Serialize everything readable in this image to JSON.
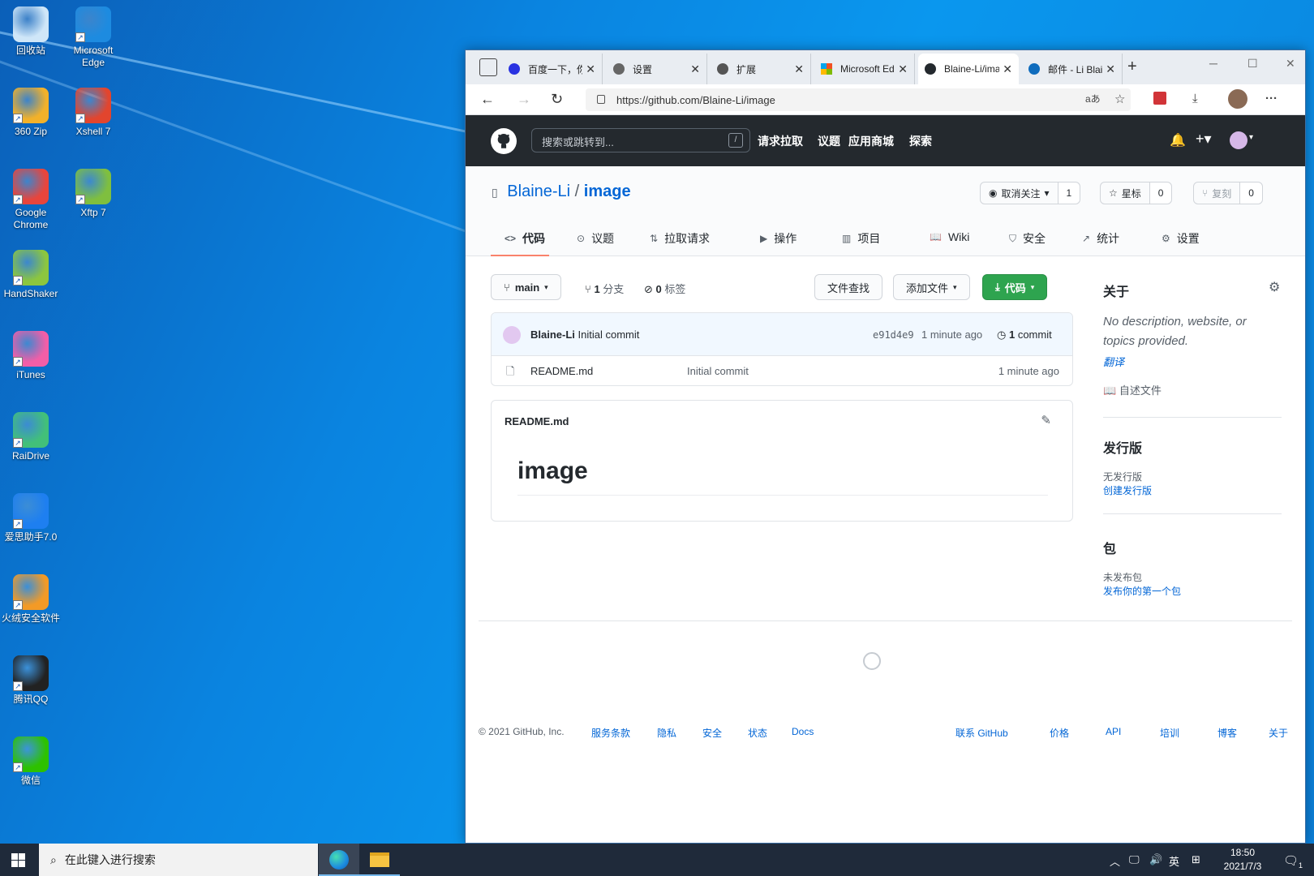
{
  "desktop": {
    "icons": [
      {
        "label": "回收站",
        "icon": "recycle-bin-icon",
        "color": "#cfe6f8"
      },
      {
        "label": "Microsoft Edge",
        "icon": "edge-icon",
        "color": "#1d8be0"
      },
      {
        "label": "360 Zip",
        "icon": "zip-archive-icon",
        "color": "#f2b12a"
      },
      {
        "label": "Xshell 7",
        "icon": "xshell-icon",
        "color": "#e2452e"
      },
      {
        "label": "Google Chrome",
        "icon": "chrome-icon",
        "color": "#e8453c"
      },
      {
        "label": "Xftp 7",
        "icon": "xftp-icon",
        "color": "#7fbf3f"
      },
      {
        "label": "HandShaker",
        "icon": "android-icon",
        "color": "#8cc63f"
      },
      {
        "label": "iTunes",
        "icon": "itunes-icon",
        "color": "#f25ea7"
      },
      {
        "label": "RaiDrive",
        "icon": "raidrive-icon",
        "color": "#42c079"
      },
      {
        "label": "爱思助手7.0",
        "icon": "i4-assistant-icon",
        "color": "#1e7ff0"
      },
      {
        "label": "火绒安全软件",
        "icon": "huorong-flame-icon",
        "color": "#f39a26"
      },
      {
        "label": "腾讯QQ",
        "icon": "qq-penguin-icon",
        "color": "#222222"
      },
      {
        "label": "微信",
        "icon": "wechat-icon",
        "color": "#2dc100"
      }
    ]
  },
  "browser": {
    "tabs": [
      {
        "title": "百度一下，你",
        "icon": "baidu-paw-icon",
        "close": "✕"
      },
      {
        "title": "设置",
        "icon": "gear-icon",
        "close": "✕"
      },
      {
        "title": "扩展",
        "icon": "puzzle-icon",
        "close": "✕"
      },
      {
        "title": "Microsoft Edge",
        "icon": "microsoft-logo-icon",
        "close": "✕"
      },
      {
        "title": "Blaine-Li/image",
        "icon": "github-icon",
        "close": "✕"
      },
      {
        "title": "邮件 - Li Blaine",
        "icon": "outlook-icon",
        "close": "✕"
      }
    ],
    "new_tab": "+",
    "url": "https://github.com/Blaine-Li/image",
    "translate_glyph": "aあ",
    "window_controls": {
      "minimize": "─",
      "maximize": "☐",
      "close": "✕"
    }
  },
  "github": {
    "search_placeholder": "搜索或跳转到...",
    "search_key": "/",
    "nav": [
      "请求拉取",
      "议题",
      "应用商城",
      "探索"
    ],
    "repo_owner": "Blaine-Li",
    "repo_sep": "/",
    "repo_name": "image",
    "watch_label": "取消关注",
    "watch_count": "1",
    "star_label": "星标",
    "star_count": "0",
    "fork_label": "复刻",
    "fork_count": "0",
    "repo_tabs": [
      {
        "label": "代码",
        "icon": "code-icon"
      },
      {
        "label": "议题",
        "icon": "issue-icon"
      },
      {
        "label": "拉取请求",
        "icon": "pull-request-icon"
      },
      {
        "label": "操作",
        "icon": "actions-play-icon"
      },
      {
        "label": "项目",
        "icon": "project-icon"
      },
      {
        "label": "Wiki",
        "icon": "book-icon"
      },
      {
        "label": "安全",
        "icon": "shield-icon"
      },
      {
        "label": "统计",
        "icon": "graph-icon"
      },
      {
        "label": "设置",
        "icon": "gear-icon"
      }
    ],
    "branch": "main",
    "branches_count": "1",
    "branches_label": "分支",
    "tags_count": "0",
    "tags_label": "标签",
    "find_file": "文件查找",
    "add_file": "添加文件",
    "code_btn": "代码",
    "commit": {
      "author": "Blaine-Li",
      "message": "Initial commit",
      "sha": "e91d4e9",
      "time": "1 minute ago",
      "count_num": "1",
      "count_word": "commit"
    },
    "files": [
      {
        "name": "README.md",
        "message": "Initial commit",
        "time": "1 minute ago"
      }
    ],
    "readme_title": "README.md",
    "readme_heading": "image",
    "about_title": "关于",
    "about_text": "No description, website, or topics provided.",
    "translate_link": "翻译",
    "readme_link": "自述文件",
    "releases_title": "发行版",
    "no_releases": "无发行版",
    "create_release": "创建发行版",
    "packages_title": "包",
    "no_packages": "未发布包",
    "publish_package": "发布你的第一个包",
    "footer_left": [
      "© 2021 GitHub, Inc.",
      "服务条款",
      "隐私",
      "安全",
      "状态",
      "Docs"
    ],
    "footer_right": [
      "联系 GitHub",
      "价格",
      "API",
      "培训",
      "博客",
      "关于"
    ]
  },
  "taskbar": {
    "search_placeholder": "在此键入进行搜索",
    "ime": "英",
    "time": "18:50",
    "date": "2021/7/3",
    "notif_count": "1"
  },
  "colors": {
    "github_header": "#24292e",
    "link_blue": "#0366d6",
    "code_green": "#2ea44f",
    "active_tab_underline": "#f9826c"
  }
}
